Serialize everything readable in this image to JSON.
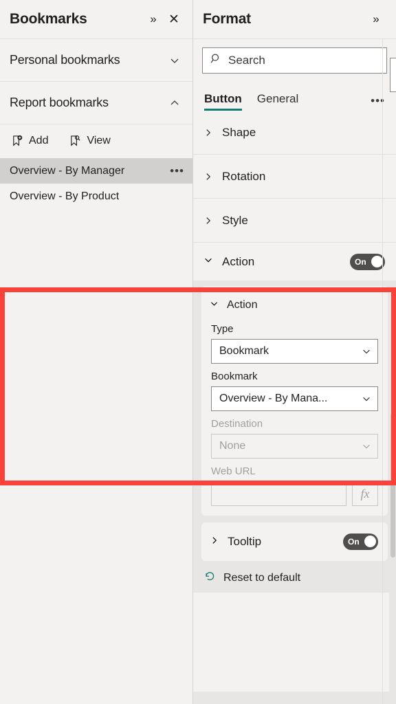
{
  "bookmarks_pane": {
    "title": "Bookmarks",
    "expand_icon": "chevron-double-right-icon",
    "close_icon": "close-icon",
    "personal": {
      "label": "Personal bookmarks",
      "state": "collapsed",
      "chevron": "chevron-down-icon"
    },
    "report": {
      "label": "Report bookmarks",
      "state": "expanded",
      "chevron": "chevron-up-icon"
    },
    "toolbar": {
      "add_label": "Add",
      "add_icon": "bookmark-add-icon",
      "view_label": "View",
      "view_icon": "bookmark-view-icon"
    },
    "items": [
      {
        "label": "Overview - By Manager",
        "selected": true,
        "more_icon": "ellipsis-icon",
        "more_label": "•••"
      },
      {
        "label": "Overview - By Product",
        "selected": false,
        "more_icon": "ellipsis-icon",
        "more_label": ""
      }
    ]
  },
  "format_pane": {
    "title": "Format",
    "expand_icon": "chevron-double-right-icon",
    "search": {
      "placeholder": "Search",
      "icon": "search-icon",
      "value": ""
    },
    "tabs": [
      {
        "label": "Button",
        "active": true
      },
      {
        "label": "General",
        "active": false
      }
    ],
    "tabs_more_label": "•••",
    "sections": [
      {
        "label": "Shape",
        "state": "collapsed",
        "chevron": "chevron-right-icon"
      },
      {
        "label": "Rotation",
        "state": "collapsed",
        "chevron": "chevron-right-icon"
      },
      {
        "label": "Style",
        "state": "collapsed",
        "chevron": "chevron-right-icon"
      }
    ],
    "action": {
      "header_label": "Action",
      "header_chevron": "chevron-down-icon",
      "toggle_label": "On",
      "toggle_state": "on",
      "sub_label": "Action",
      "sub_chevron": "chevron-down-icon",
      "type_field": {
        "label": "Type",
        "value": "Bookmark",
        "chevron": "chevron-down-icon",
        "disabled": false
      },
      "bookmark_field": {
        "label": "Bookmark",
        "value": "Overview - By Mana...",
        "chevron": "chevron-down-icon",
        "disabled": false
      },
      "destination_field": {
        "label": "Destination",
        "value": "None",
        "chevron": "chevron-down-icon",
        "disabled": true
      },
      "web_url_field": {
        "label": "Web URL",
        "value": "",
        "fx_label": "fx",
        "disabled": true
      }
    },
    "tooltip": {
      "label": "Tooltip",
      "chevron": "chevron-right-icon",
      "toggle_label": "On",
      "toggle_state": "on"
    },
    "reset": {
      "label": "Reset to default",
      "icon": "undo-icon"
    }
  },
  "colors": {
    "accent_teal": "#127d6e",
    "annotation_red": "#f9423a",
    "toggle_on": "#4f4e4c",
    "selected_row": "#d2d0ce",
    "panel_bg": "#f3f2f1"
  }
}
